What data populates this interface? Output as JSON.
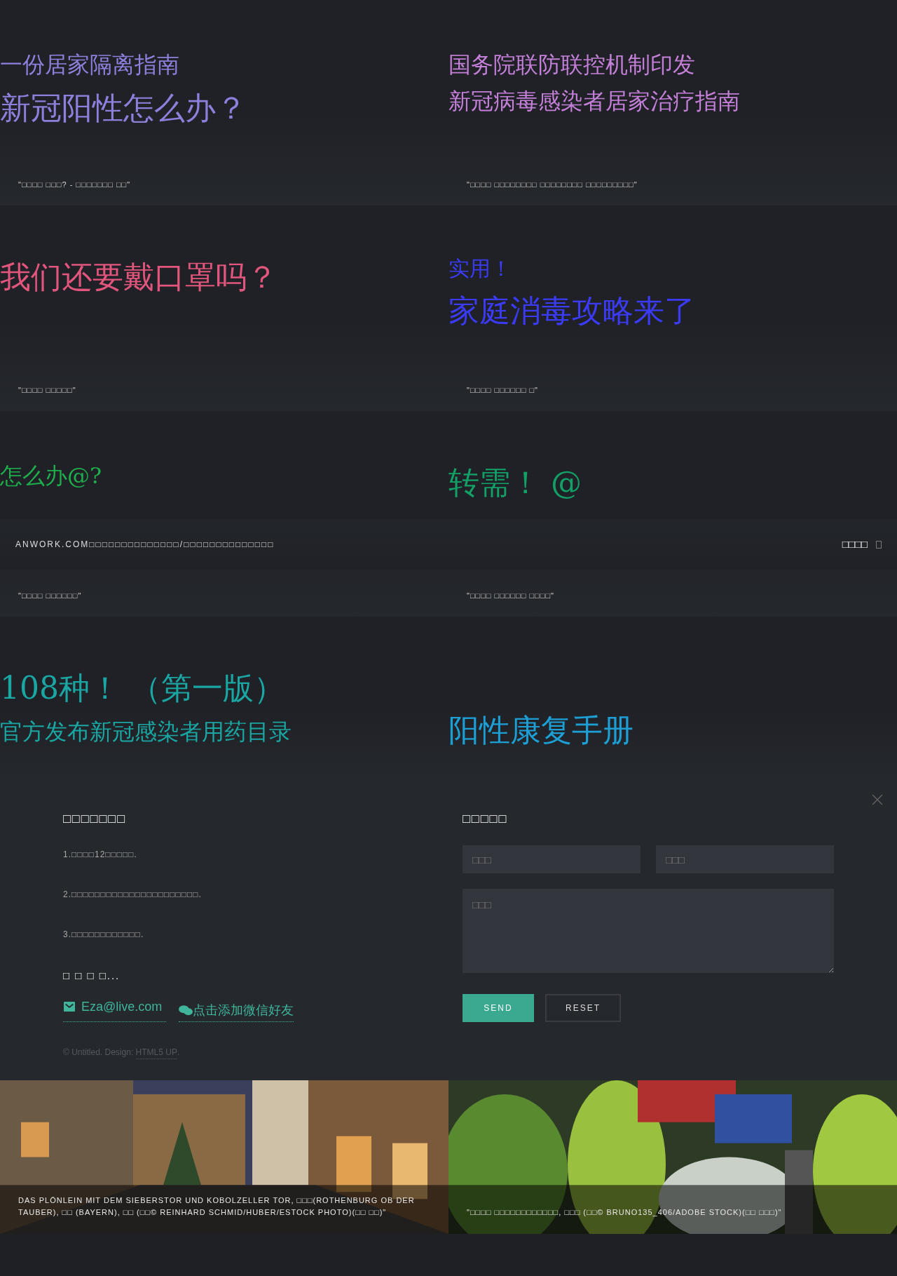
{
  "tiles": [
    {
      "color": "#8c80dc",
      "lines": [
        {
          "text": "一份居家隔离指南",
          "kind": "small"
        },
        {
          "text": "新冠阳性怎么办？",
          "kind": "large"
        }
      ],
      "caption": "\"□□□□ □□□? - □□□□□□□ □□\""
    },
    {
      "color": "#c47fd8",
      "lines": [
        {
          "text": "国务院联防联控机制印发",
          "kind": "small"
        },
        {
          "text": "新冠病毒感染者居家治疗指南",
          "kind": "small"
        }
      ],
      "caption": "\"□□□□ □□□□□□□□ □□□□□□□□ □□□□□□□□□\""
    },
    {
      "color": "#e2557c",
      "lines": [
        {
          "text": "我们还要戴口罩吗？",
          "kind": "large"
        }
      ],
      "caption": "\"□□□□ □□□□□\""
    },
    {
      "color": "#3b3bf5",
      "lines": [
        {
          "text": "实用！",
          "kind": "tiny"
        },
        {
          "text": "家庭消毒攻略来了",
          "kind": "large"
        }
      ],
      "caption": "\"□□□□ □□□□□□ □\""
    },
    {
      "color": "#1fae4c",
      "lines": [
        {
          "text": "怎么办@?",
          "kind": "small"
        }
      ],
      "caption": "\"□□□□ □□□□□□\""
    },
    {
      "color": "#13a067",
      "lines": [
        {
          "text": "转需！ @",
          "kind": "large"
        }
      ],
      "caption": "\"□□□□ □□□□□□ □□□□\""
    },
    {
      "color": "#1aa6a2",
      "lines": [
        {
          "text": "108种！ （第一版）",
          "kind": "large"
        },
        {
          "text": "官方发布新冠感染者用药目录",
          "kind": "small"
        }
      ]
    },
    {
      "color": "#1d9fd6",
      "lines": [
        {
          "text": "阳性康复手册",
          "kind": "large"
        }
      ]
    }
  ],
  "banner": {
    "text": "ANWORK.COM□□□□□□□□□□□□□□/□□□□□□□□□□□□□□",
    "action": "□□□□"
  },
  "footer": {
    "heading": "□□□□□□□",
    "items": [
      "1.□□□□12□□□□□.",
      "2.□□□□□□□□□□□□□□□□□□□□□□.",
      "3.□□□□□□□□□□□□."
    ],
    "more": "□ □ □ □...",
    "email": "Eza@live.com",
    "wechat": "点击添加微信好友",
    "copyright": "© Untitled. Design: ",
    "credit": "HTML5 UP",
    "credit_end": ".",
    "form_heading": "□□□□□",
    "name_placeholder": "□□□",
    "email_placeholder": "□□□",
    "message_placeholder": "□□□",
    "send": "SEND",
    "reset": "RESET"
  },
  "photos": [
    {
      "caption": "DAS PLÖNLEIN MIT DEM SIEBERSTOR UND KOBOLZELLER TOR, □□□(ROTHENBURG OB DER TAUBER), □□ (BAYERN), □□ (□□© REINHARD SCHMID/HUBER/ESTOCK PHOTO)(□□ □□)\""
    },
    {
      "caption": "\"□□□□ □□□□□□□□□□□□, □□□ (□□© BRUNO135_406/ADOBE STOCK)(□□ □□□)\""
    }
  ]
}
